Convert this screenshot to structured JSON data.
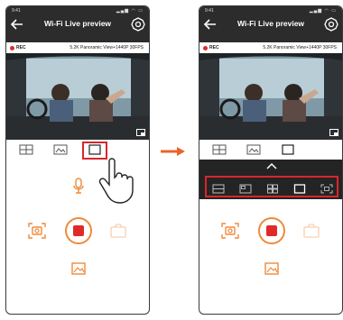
{
  "app": {
    "status_time": "9:41",
    "title": "Wi-Fi Live preview",
    "rec_label": "REC",
    "mode_text": "5.2K Panoramic View+1440P 30FPS"
  },
  "view_modes": [
    "front-view-icon",
    "rear-view-icon",
    "single-view-icon"
  ],
  "layout_options": [
    "split-horizontal-icon",
    "pip-icon",
    "quad-grid-icon",
    "single-view-icon",
    "fullscreen-icon"
  ],
  "colors": {
    "accent_orange": "#f08a3a",
    "record_red": "#e02a2a",
    "highlight_red": "#d9262c",
    "appbar": "#2c2c2c"
  }
}
